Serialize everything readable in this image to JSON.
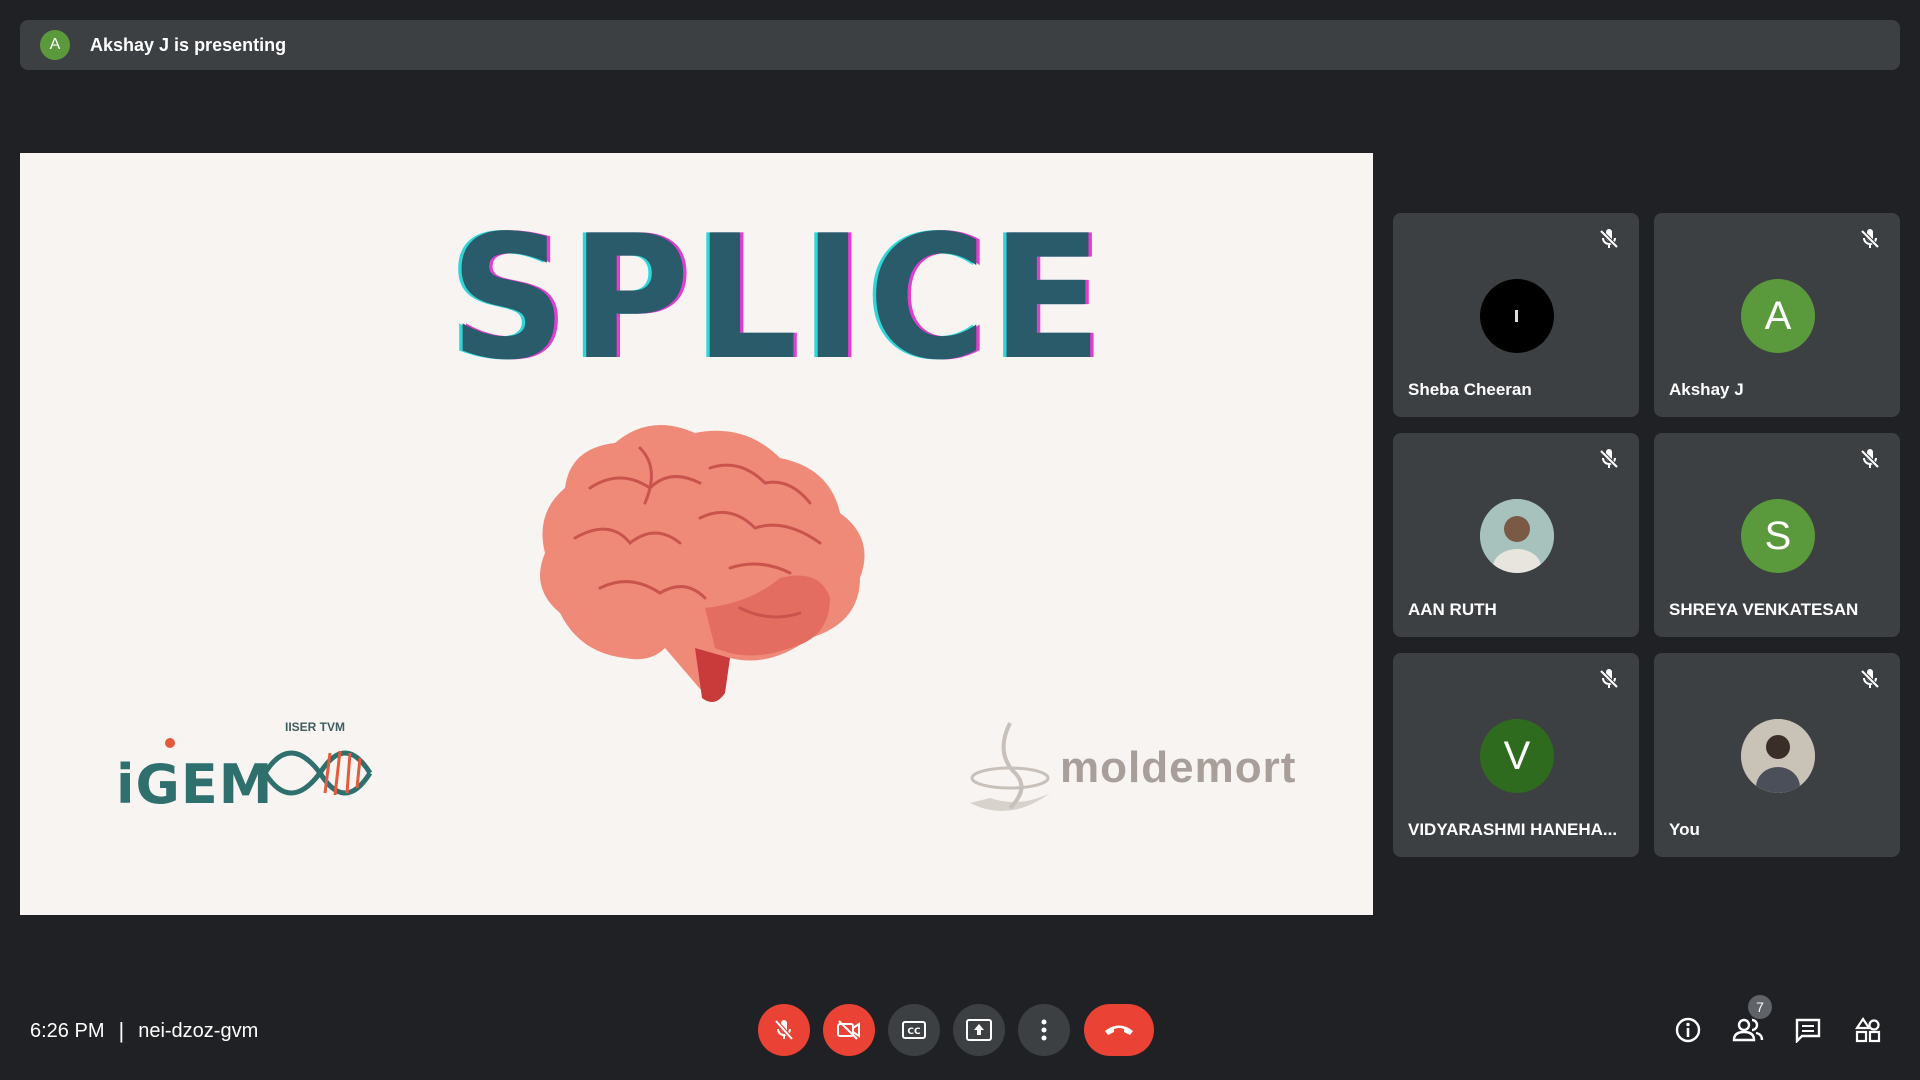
{
  "banner": {
    "avatar_letter": "A",
    "text": "Akshay J is presenting",
    "avatar_color": "#5b9a3c"
  },
  "slide": {
    "title": "SPLICE",
    "left_logo_sub": "IISER TVM",
    "left_logo_text": "iGEM",
    "right_logo_text": "moldemort"
  },
  "participants": [
    {
      "name": "Sheba Cheeran",
      "avatar": "photo-dark",
      "muted": true
    },
    {
      "name": "Akshay J",
      "avatar_letter": "A",
      "avatar_color": "#5b9a3c",
      "muted": true
    },
    {
      "name": "AAN RUTH",
      "avatar": "photo",
      "muted": true
    },
    {
      "name": "SHREYA VENKATESAN",
      "avatar_letter": "S",
      "avatar_color": "#5b9a3c",
      "muted": true
    },
    {
      "name": "VIDYARASHMI HANEHA...",
      "avatar_letter": "V",
      "avatar_color": "#2e6b1f",
      "muted": true
    },
    {
      "name": "You",
      "avatar": "photo",
      "muted": true
    }
  ],
  "footer": {
    "time": "6:26 PM",
    "separator": "|",
    "meeting_code": "nei-dzoz-gvm",
    "people_count": "7"
  },
  "controls": [
    "mic-off-icon",
    "camera-off-icon",
    "captions-icon",
    "present-icon",
    "more-icon",
    "hangup-icon"
  ],
  "right_controls": [
    "info-icon",
    "people-icon",
    "chat-icon",
    "activities-icon"
  ],
  "colors": {
    "background": "#202124",
    "tile": "#3c4043",
    "danger": "#ea4335"
  }
}
